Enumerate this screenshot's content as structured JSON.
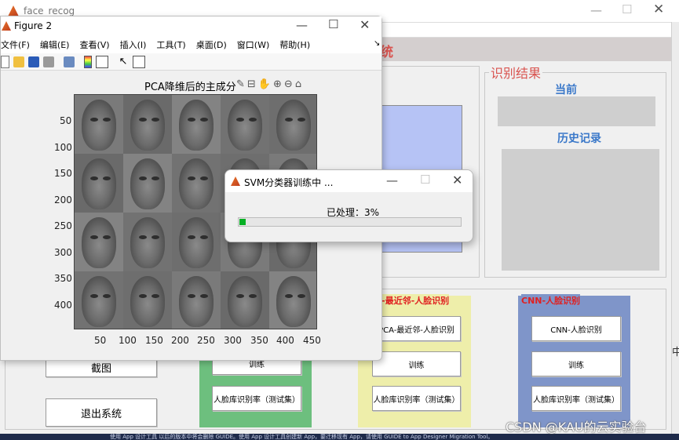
{
  "main_window": {
    "title": "face_recog",
    "title_fragment": "统",
    "result_panel": {
      "title": "识别结果",
      "current_label": "当前",
      "history_label": "历史记录"
    },
    "button_capture": "截图",
    "button_exit": "退出系统",
    "green_panel": {
      "train_button": "训练",
      "accuracy_button": "人脸库识别率（测试集）"
    },
    "yellow_panel": {
      "title": "-最近邻-人脸识别",
      "recog_button": "PCA-最近邻-人脸识别",
      "train_button": "训练",
      "accuracy_button": "人脸库识别率（测试集）"
    },
    "blue_panel": {
      "title": "CNN-人脸识别",
      "recog_button": "CNN-人脸识别",
      "train_button": "训练",
      "accuracy_button": "人脸库识别率（测试集）"
    },
    "right_edge_char": "中",
    "footer_text": "使用 App 设计工具  以后的版本中将会删除 GUIDE。使用 App 设计工具创建新 App，要迁移现有 App，请使用 GUIDE to App Designer Migration Tool。"
  },
  "figure_window": {
    "title": "Figure 2",
    "menu": [
      "文件(F)",
      "编辑(E)",
      "查看(V)",
      "插入(I)",
      "工具(T)",
      "桌面(D)",
      "窗口(W)",
      "帮助(H)"
    ],
    "toolbar_icons": [
      "new-file-icon",
      "open-folder-icon",
      "save-icon",
      "print-icon",
      "link-icon",
      "colorbar-icon",
      "legend-icon",
      "pointer-icon",
      "property-icon"
    ],
    "axes_title": "PCA降维后的主成分",
    "axes_toolbar_icons": [
      "brush-icon",
      "data-tips-icon",
      "pan-icon",
      "zoom-in-icon",
      "zoom-out-icon",
      "home-icon"
    ],
    "y_ticks": [
      "50",
      "100",
      "150",
      "200",
      "250",
      "300",
      "350",
      "400"
    ],
    "x_ticks": [
      "50",
      "100",
      "150",
      "200",
      "250",
      "300",
      "350",
      "400",
      "450"
    ],
    "grid": {
      "rows": 4,
      "cols": 5
    }
  },
  "progress_dialog": {
    "title": "SVM分类器训练中 ...",
    "status": "已处理：3%",
    "progress": 0.03
  },
  "watermark": "CSDN @KAU的云实验台"
}
